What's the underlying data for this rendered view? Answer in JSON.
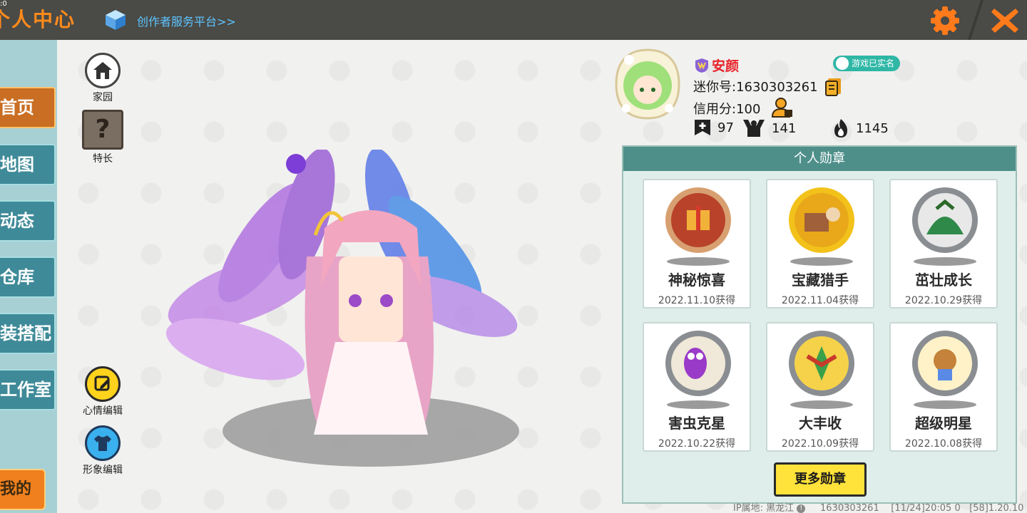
{
  "header": {
    "title": "个人中心",
    "corner_time": ":0",
    "creator_link": "创作者服务平台>>"
  },
  "nav": {
    "items": [
      {
        "label": "首页",
        "active": true
      },
      {
        "label": "地图"
      },
      {
        "label": "动态"
      },
      {
        "label": "仓库"
      },
      {
        "label": "装搭配"
      },
      {
        "label": "工作室"
      }
    ],
    "mine_label": "我的"
  },
  "tools": {
    "home_label": "家园",
    "talent_label": "特长",
    "talent_glyph": "?",
    "mood_label": "心情编辑",
    "look_label": "形象编辑"
  },
  "profile": {
    "name": "安颜",
    "verified": "游戏已实名",
    "mini_id": "迷你号:1630303261",
    "credit": "信用分:100",
    "stats": {
      "likes": "97",
      "fans": "141",
      "heat": "1145"
    }
  },
  "medals": {
    "header": "个人勋章",
    "items": [
      {
        "name": "神秘惊喜",
        "date": "2022.11.10获得",
        "color": "#b8432a"
      },
      {
        "name": "宝藏猎手",
        "date": "2022.11.04获得",
        "color": "#e8b21e"
      },
      {
        "name": "茁壮成长",
        "date": "2022.10.29获得",
        "color": "#8a8e92"
      },
      {
        "name": "害虫克星",
        "date": "2022.10.22获得",
        "color": "#8a8e92"
      },
      {
        "name": "大丰收",
        "date": "2022.10.09获得",
        "color": "#8a8e92"
      },
      {
        "name": "超级明星",
        "date": "2022.10.08获得",
        "color": "#8a8e92"
      }
    ],
    "more_label": "更多勋章"
  },
  "footer": {
    "ip_label": "IP属地: 黑龙江",
    "id": "1630303261",
    "time": "[11/24]20:05 0",
    "version": "[58]1.20.10"
  },
  "colors": {
    "accent_orange": "#ff8a1c",
    "nav_teal": "#3f8a98",
    "panel_teal": "#4e8f8a",
    "name_red": "#e8232a"
  }
}
